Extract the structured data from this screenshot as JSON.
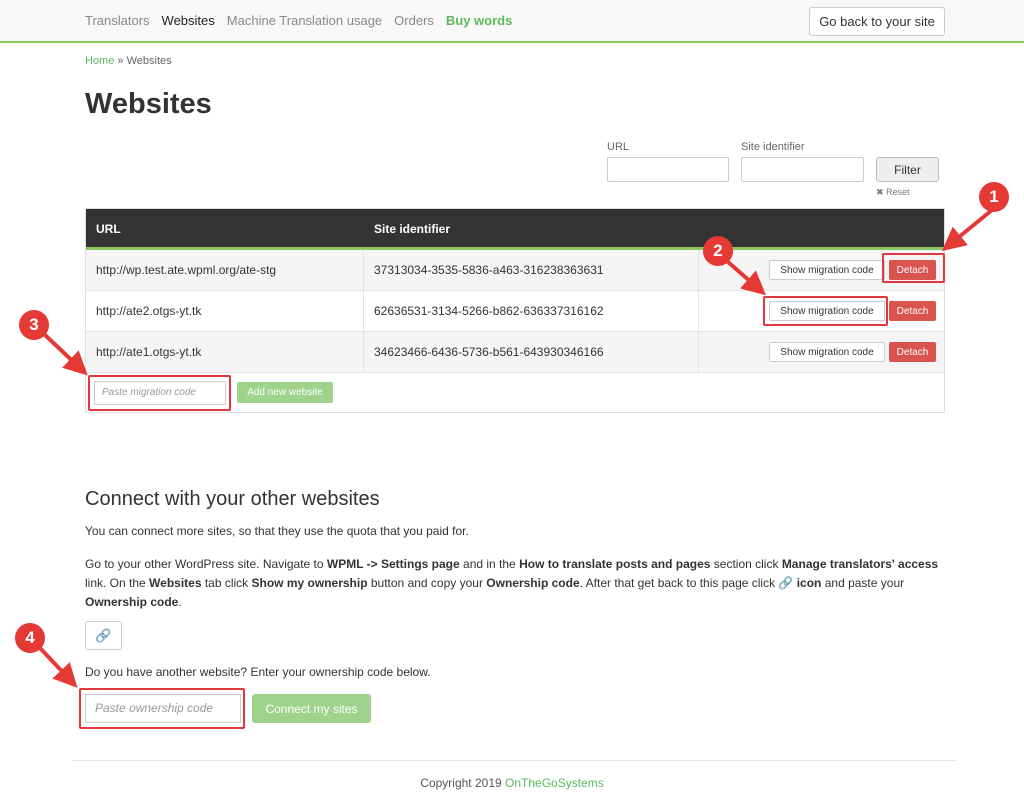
{
  "nav": {
    "items": [
      "Translators",
      "Websites",
      "Machine Translation usage",
      "Orders"
    ],
    "buy": "Buy words",
    "back_button": "Go back to your site"
  },
  "breadcrumb": {
    "home": "Home",
    "separator": "»",
    "current": "Websites"
  },
  "page_title": "Websites",
  "filter": {
    "url_label": "URL",
    "url_value": "",
    "site_label": "Site identifier",
    "site_value": "",
    "filter_button": "Filter",
    "reset": "✖ Reset"
  },
  "table": {
    "headers": [
      "URL",
      "Site identifier"
    ],
    "rows": [
      {
        "url": "http://wp.test.ate.wpml.org/ate-stg",
        "id": "37313034-3535-5836-a463-316238363631"
      },
      {
        "url": "http://ate2.otgs-yt.tk",
        "id": "62636531-3134-5266-b862-636337316162"
      },
      {
        "url": "http://ate1.otgs-yt.tk",
        "id": "34623466-6436-5736-b561-643930346166"
      }
    ],
    "show_migration": "Show migration code",
    "detach": "Detach",
    "migration_placeholder": "Paste migration code",
    "add_button": "Add new website"
  },
  "connect": {
    "title": "Connect with your other websites",
    "para1": "You can connect more sites, so that they use the quota that you paid for.",
    "p2": {
      "a": "Go to your other WordPress site. Navigate to ",
      "b": "WPML -> Settings page",
      "c": " and in the ",
      "d": "How to translate posts and pages",
      "e": " section click ",
      "f": "Manage translators' access",
      "g": " link. On the ",
      "h": "Websites",
      "i": " tab click ",
      "j": "Show my ownership",
      "k": " button and copy your ",
      "l": "Ownership code",
      "m": ". After that get back to this page click ",
      "n": " icon",
      "o": " and paste your ",
      "p": "Ownership code",
      "q": "."
    },
    "question": "Do you have another website? Enter your ownership code below.",
    "ownership_placeholder": "Paste ownership code",
    "connect_button": "Connect my sites"
  },
  "footer": {
    "copyright": "Copyright 2019 ",
    "company": "OnTheGoSystems"
  },
  "badges": [
    "1",
    "2",
    "3",
    "4"
  ],
  "colors": {
    "accent_green": "#8cc864",
    "detach_red": "#d9534f",
    "annotation_red": "#e53935",
    "header_dark": "#333333"
  },
  "icons": {
    "link": "link-icon",
    "reset": "close-icon"
  }
}
